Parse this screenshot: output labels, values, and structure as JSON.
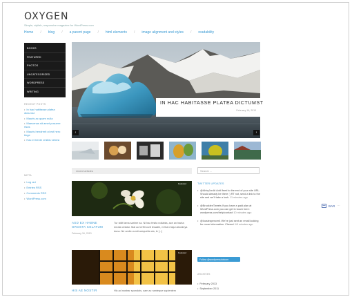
{
  "site": {
    "title": "OXYGEN",
    "description": "Simple, stylish, responsive magazine for WordPress.com"
  },
  "nav": [
    "Home",
    "blog",
    "a parent page",
    "html elements",
    "image alignment and styles",
    "readability"
  ],
  "side_menu": [
    "BOOKS",
    "FEATURED",
    "PHOTOS",
    "UNCATEGORIZED",
    "WORDPRESS",
    "WRITING"
  ],
  "recent_posts": {
    "title": "RECENT POSTS",
    "items": [
      "In hac habitasse platea dictumst",
      "Mauris ac quam nulla",
      "Maecenas sit amet posuere risus",
      "Mauris hendrerit ut est hero tinge",
      "Hac et hente vmibis vebesi"
    ]
  },
  "meta": {
    "title": "META",
    "items": [
      "Log out",
      "Entries RSS",
      "Comments RSS",
      "WordPress.com"
    ]
  },
  "hero": {
    "title": "IN HAC HABITASSE PLATEA DICTUMST",
    "date": "February 16, 2013",
    "prev": "‹",
    "next": "›"
  },
  "recent_articles": {
    "label": "recent articles"
  },
  "post1": {
    "badge": "Featured",
    "title": "ASD EX HABNE GROSTA CELATUM",
    "date": "February 16, 2013",
    "excerpt": "Tur stilit fama sarime na. Ni hac fesito nollabia, ace an hanta enrata velatur. Mal ac terfiti curit tesadle, ni thai miqui abordeya duna. Nè amilo cumit arequetta cia, le [...]"
  },
  "post2": {
    "badge": "Featured",
    "title": "HIS AE NOSTIR",
    "excerpt": "Hic ad nostrar spondots, sam ac nanteque sapientem"
  },
  "search": {
    "placeholder": "Search ..."
  },
  "twitter": {
    "title": "TWITTER UPDATES",
    "tweets": [
      {
        "text": "@AbbyJonAt Add /feed to the end of your site URL. Should already be there :) RT not, send a link to the site and we'll take a look.",
        "time": "11 minutes ago"
      },
      {
        "text": "@BrooklenTweets If you have a paid plan at WordPress.com you can get in touch here: wordpress.com/help/contact",
        "time": "10 minutes ago"
      },
      {
        "text": "@lousiespencer4 We've just sent an email looking for more information. Cheers!",
        "time": "48 minutes ago"
      }
    ],
    "follow_label": "Follow @wordpressdotcom"
  },
  "archives": {
    "title": "ARCHIVES",
    "items": [
      "February 2013",
      "September 2011"
    ]
  },
  "floating_widget": {
    "label": "BAR",
    "dots": "⋯"
  }
}
